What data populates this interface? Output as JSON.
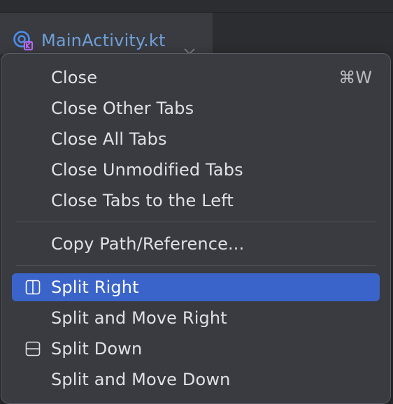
{
  "editor": {
    "tab": {
      "title": "MainActivity.kt",
      "icon": "kotlin-activity-icon",
      "close_icon": "close-icon"
    }
  },
  "context_menu": {
    "items": [
      {
        "label": "Close",
        "shortcut": "⌘W"
      },
      {
        "label": "Close Other Tabs"
      },
      {
        "label": "Close All Tabs"
      },
      {
        "label": "Close Unmodified Tabs"
      },
      {
        "label": "Close Tabs to the Left"
      },
      {
        "label": "Copy Path/Reference..."
      },
      {
        "label": "Split Right",
        "icon": "split-vertical-icon",
        "selected": true
      },
      {
        "label": "Split and Move Right"
      },
      {
        "label": "Split Down",
        "icon": "split-horizontal-icon"
      },
      {
        "label": "Split and Move Down"
      }
    ]
  },
  "colors": {
    "selection": "#3a64c9",
    "menu_background": "#393b40",
    "tab_title": "#6f9fd8"
  }
}
